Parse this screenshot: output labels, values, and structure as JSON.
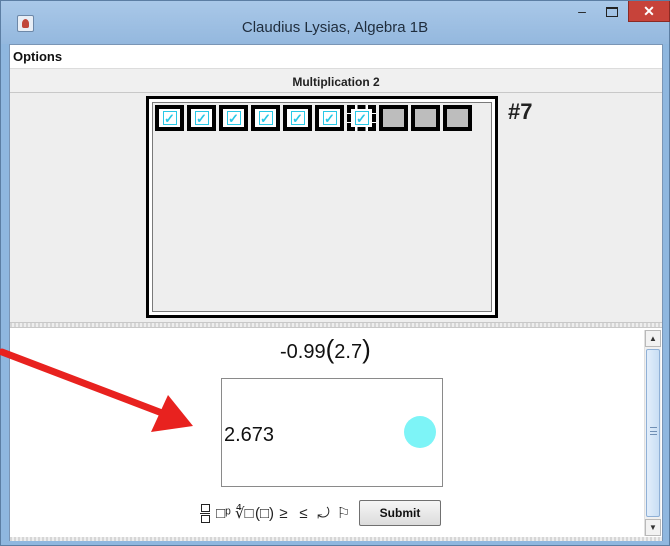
{
  "window": {
    "title": "Claudius Lysias, Algebra 1B",
    "minimize_symbol": "–",
    "close_symbol": "✕"
  },
  "menu": {
    "options_label": "Options"
  },
  "section": {
    "title": "Multiplication 2"
  },
  "progress": {
    "problem_number": "#7",
    "check_mark": "✓",
    "cells": [
      "done",
      "done",
      "done",
      "done",
      "done",
      "done",
      "current",
      "empty",
      "empty",
      "empty"
    ]
  },
  "problem": {
    "expression_prefix": "-0.99",
    "open_paren": "(",
    "inner_value": "2.7",
    "close_paren": ")"
  },
  "answer": {
    "value": "2.673",
    "status_color": "#7df4f7"
  },
  "toolbar": {
    "fraction_tool": "fraction-icon",
    "exponent_tool": "□ᵖ",
    "root_tool": "∜□",
    "parentheses_tool": "(□)",
    "greater_equal_tool": "≥",
    "less_equal_tool": "≤",
    "undo_tool": "⤾",
    "flag_tool": "⚐",
    "submit_label": "Submit"
  },
  "annotation": {
    "arrow_color": "#e8221f"
  }
}
